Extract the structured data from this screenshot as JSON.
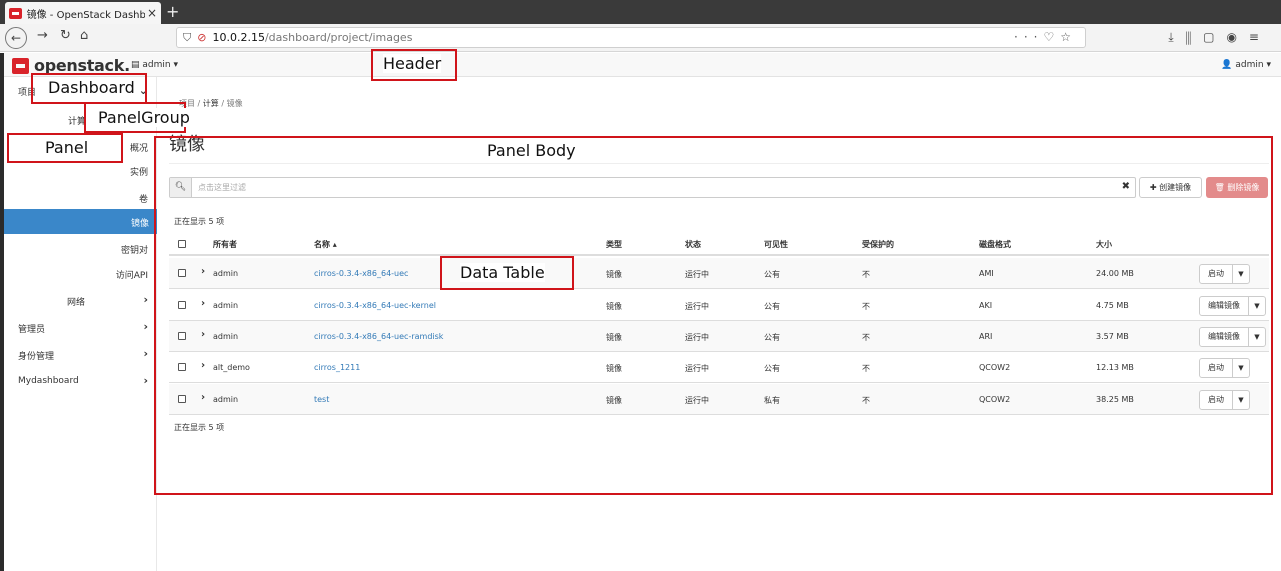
{
  "browser": {
    "tab_title": "镜像 - OpenStack Dashb",
    "tab_close": "×",
    "new_tab": "+",
    "url_host": "10.0.2.15",
    "url_path": "/dashboard/project/images",
    "icons": [
      "back-icon",
      "forward-icon",
      "reload-icon",
      "home-icon",
      "shield-icon",
      "insecure-lock-icon",
      "more-icon",
      "pocket-icon",
      "bookmark-star-icon",
      "download-icon",
      "library-icon",
      "sidebar-icon",
      "account-icon",
      "menu-icon"
    ]
  },
  "header": {
    "logo_text": "openstack.",
    "project": "admin",
    "user": "admin"
  },
  "sidebar": {
    "project": "项目",
    "compute": "计算",
    "items": [
      "概况",
      "实例",
      "卷",
      "镜像",
      "密钥对",
      "访问API"
    ],
    "network": "网络",
    "admin": "管理员",
    "identity": "身份管理",
    "mydashboard": "Mydashboard"
  },
  "breadcrumb": {
    "project": "项目",
    "compute": "计算",
    "images": "镜像",
    "sep": "/"
  },
  "page": {
    "title": "镜像",
    "filter_placeholder": "点击这里过滤",
    "create_button": "✚ 创建镜像",
    "delete_button": "🗑 删除镜像",
    "count_top": "正在显示 5 项",
    "count_bottom": "正在显示 5 项"
  },
  "table": {
    "columns": [
      "所有者",
      "名称 ▴",
      "类型",
      "状态",
      "可见性",
      "受保护的",
      "磁盘格式",
      "大小"
    ],
    "rows": [
      {
        "owner": "admin",
        "name": "cirros-0.3.4-x86_64-uec",
        "type": "镜像",
        "status": "运行中",
        "visibility": "公有",
        "protected": "不",
        "format": "AMI",
        "size": "24.00 MB",
        "action": "启动"
      },
      {
        "owner": "admin",
        "name": "cirros-0.3.4-x86_64-uec-kernel",
        "type": "镜像",
        "status": "运行中",
        "visibility": "公有",
        "protected": "不",
        "format": "AKI",
        "size": "4.75 MB",
        "action": "编辑镜像"
      },
      {
        "owner": "admin",
        "name": "cirros-0.3.4-x86_64-uec-ramdisk",
        "type": "镜像",
        "status": "运行中",
        "visibility": "公有",
        "protected": "不",
        "format": "ARI",
        "size": "3.57 MB",
        "action": "编辑镜像"
      },
      {
        "owner": "alt_demo",
        "name": "cirros_1211",
        "type": "镜像",
        "status": "运行中",
        "visibility": "公有",
        "protected": "不",
        "format": "QCOW2",
        "size": "12.13 MB",
        "action": "启动"
      },
      {
        "owner": "admin",
        "name": "test",
        "type": "镜像",
        "status": "运行中",
        "visibility": "私有",
        "protected": "不",
        "format": "QCOW2",
        "size": "38.25 MB",
        "action": "启动"
      }
    ]
  },
  "annotations": {
    "header": "Header",
    "dashboard": "Dashboard",
    "panel_group": "PanelGroup",
    "panel": "Panel",
    "panel_body": "Panel Body",
    "data_table": "Data Table"
  },
  "colors": {
    "accent": "#3a87c9",
    "annotation": "#d0141a",
    "danger": "#e38b8b",
    "link": "#337ab7"
  }
}
